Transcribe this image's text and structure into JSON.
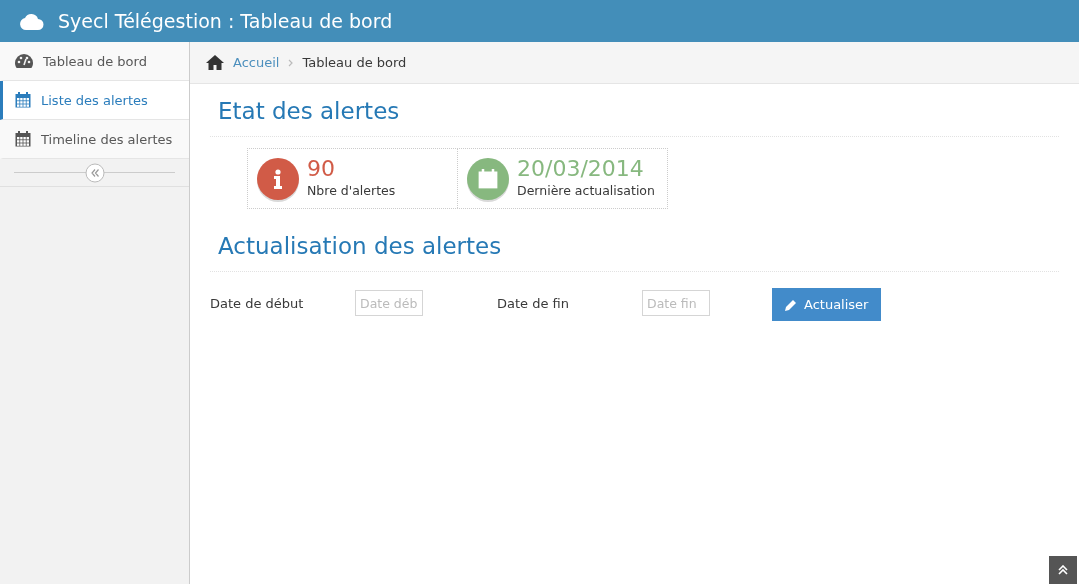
{
  "window": {
    "title": "Syecl Télégestion : Tableau de bord"
  },
  "sidebar": {
    "items": [
      {
        "label": "Tableau de bord",
        "kind": "gauge",
        "selected": false
      },
      {
        "label": "Liste des alertes",
        "kind": "calendar",
        "selected": true
      },
      {
        "label": "Timeline des alertes",
        "kind": "calendar",
        "selected": false
      }
    ]
  },
  "breadcrumb": [
    {
      "label": "Accueil",
      "kind": "link"
    },
    {
      "label": "Tableau de bord",
      "kind": "current"
    }
  ],
  "sections": [
    {
      "title": "Etat des alertes",
      "kind": "stats",
      "stats": [
        {
          "value": "90",
          "label": "Nbre d'alertes",
          "kind": "info",
          "color": "#d15b47"
        },
        {
          "value": "20/03/2014",
          "label": "Dernière actualisation",
          "kind": "calendar",
          "color": "#87b87f"
        }
      ]
    },
    {
      "title": "Actualisation des alertes",
      "kind": "form",
      "fields": [
        {
          "label": "Date de début",
          "placeholder": "Date déb"
        },
        {
          "label": "Date de fin",
          "placeholder": "Date fin"
        }
      ],
      "button": "Actualiser"
    }
  ]
}
